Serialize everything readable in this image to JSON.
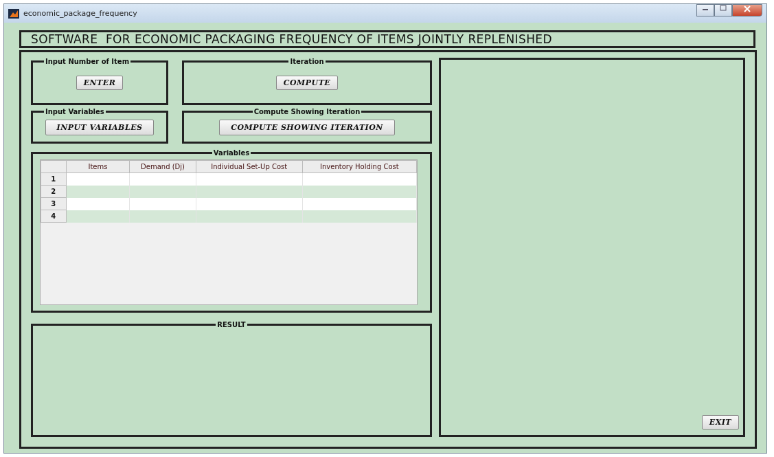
{
  "window": {
    "title": "economic_package_frequency"
  },
  "header": "SOFTWARE  FOR ECONOMIC PACKAGING FREQUENCY OF ITEMS JOINTLY REPLENISHED",
  "groups": [
    {
      "title": "Input Number of Item",
      "button": "ENTER"
    },
    {
      "title": "Iteration",
      "button": "COMPUTE"
    },
    {
      "title": "Input Variables",
      "button": "INPUT VARIABLES"
    },
    {
      "title": "Compute Showing Iteration",
      "button": "COMPUTE SHOWING ITERATION"
    }
  ],
  "variables": {
    "title": "Variables",
    "columns": [
      "Items",
      "Demand (Dj)",
      "Individual Set-Up Cost",
      "Inventory Holding Cost"
    ],
    "rows": [
      {
        "label": "1"
      },
      {
        "label": "2"
      },
      {
        "label": "3"
      },
      {
        "label": "4"
      }
    ]
  },
  "result": {
    "title": "RESULT"
  },
  "exit_button": "EXIT"
}
